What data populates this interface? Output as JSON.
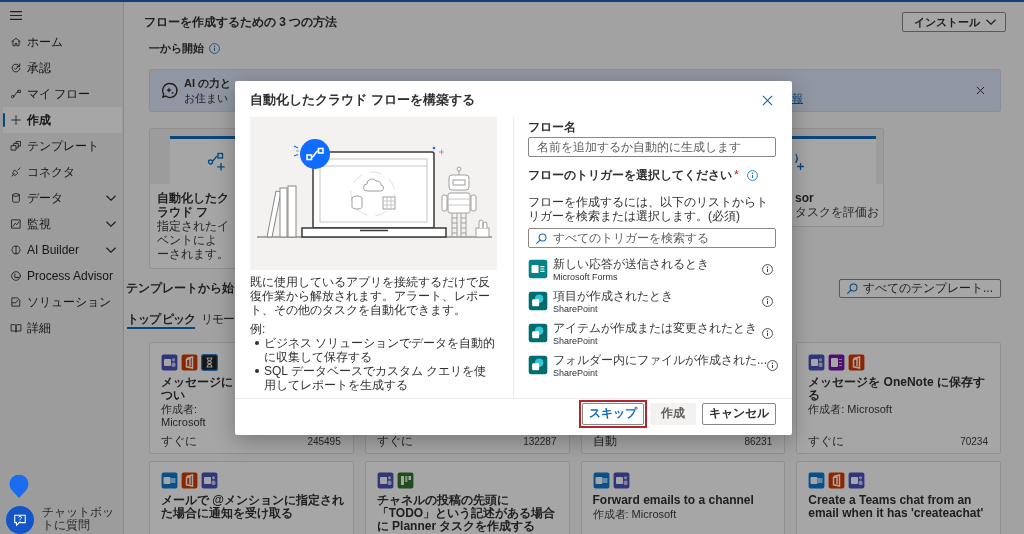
{
  "sidebar": {
    "items": [
      {
        "label": "ホーム",
        "selected": false,
        "expandable": false
      },
      {
        "label": "承認",
        "selected": false,
        "expandable": false
      },
      {
        "label": "マイ フロー",
        "selected": false,
        "expandable": false
      },
      {
        "label": "作成",
        "selected": true,
        "expandable": false
      },
      {
        "label": "テンプレート",
        "selected": false,
        "expandable": false
      },
      {
        "label": "コネクタ",
        "selected": false,
        "expandable": false
      },
      {
        "label": "データ",
        "selected": false,
        "expandable": true
      },
      {
        "label": "監視",
        "selected": false,
        "expandable": true
      },
      {
        "label": "AI Builder",
        "selected": false,
        "expandable": true
      },
      {
        "label": "Process Advisor",
        "selected": false,
        "expandable": false
      },
      {
        "label": "ソリューション",
        "selected": false,
        "expandable": false
      },
      {
        "label": "詳細",
        "selected": false,
        "expandable": false
      }
    ],
    "chatbot_label": "チャットボットに質問"
  },
  "header": {
    "title": "フローを作成するための 3 つの方法",
    "install_button": "インストール"
  },
  "start": {
    "heading": "一から開始",
    "banner": {
      "title": "AI の力と",
      "subtitle": "お住まい",
      "link": "報"
    },
    "cards": [
      {
        "kind": "automated",
        "title": "自動化したクラウド フ",
        "description_lines": [
          "指定されたイベントによ",
          "ーされます。"
        ]
      },
      {
        "kind": "advisor",
        "title": "sor",
        "description_lines": [
          "タスクを評価お"
        ]
      }
    ]
  },
  "templates": {
    "heading": "テンプレートから始",
    "search_button": "すべてのテンプレート...",
    "tabs": [
      {
        "label": "トップ ピック",
        "selected": true
      },
      {
        "label": "リモー",
        "selected": false
      }
    ],
    "rows": [
      {
        "cards": [
          {
            "apps": [
              {
                "kind": "teams"
              },
              {
                "kind": "office"
              },
              {
                "kind": "timer"
              }
            ],
            "title": "メッセージについ",
            "author": "作成者: Microsoft",
            "trigger": "すぐに",
            "count": "245495"
          },
          {
            "trigger": "すぐに",
            "count": "132287"
          },
          {
            "trigger": "自動",
            "count": "86231"
          },
          {
            "apps": [
              {
                "kind": "teams"
              },
              {
                "kind": "onenote"
              },
              {
                "kind": "office"
              }
            ],
            "title": "メッセージを OneNote に保存する",
            "author": "作成者: Microsoft",
            "trigger": "すぐに",
            "count": "70234"
          }
        ]
      },
      {
        "cards": [
          {
            "apps": [
              {
                "kind": "outlook"
              },
              {
                "kind": "office"
              },
              {
                "kind": "teams"
              }
            ],
            "title": "メールで @メンションに指定された場合に通知を受け取る"
          },
          {
            "apps": [
              {
                "kind": "teams"
              },
              {
                "kind": "planner"
              }
            ],
            "title": "チャネルの投稿の先頭に「TODO」という記述がある場合に Planner タスクを作成する"
          },
          {
            "apps": [
              {
                "kind": "outlook"
              },
              {
                "kind": "teams"
              }
            ],
            "title": "Forward emails to a channel",
            "author": "作成者: Microsoft"
          },
          {
            "apps": [
              {
                "kind": "outlook"
              },
              {
                "kind": "office"
              },
              {
                "kind": "teams"
              }
            ],
            "title": "Create a Teams chat from an email when it has 'createachat'"
          }
        ]
      }
    ]
  },
  "dialog": {
    "title": "自動化したクラウド フローを構築する",
    "description": "既に使用しているアプリを接続するだけで反復作業から解放されます。アラート、レポート、その他のタスクを自動化できます。",
    "examples_label": "例:",
    "examples": [
      "ビジネス ソリューションでデータを自動的に収集して保存する",
      "SQL データベースでカスタム クエリを使用してレポートを生成する"
    ],
    "name_field": {
      "label": "フロー名",
      "placeholder": "名前を追加するか自動的に生成します"
    },
    "trigger_field": {
      "label": "フローのトリガーを選択してください",
      "required_mark": "*",
      "help": "フローを作成するには、以下のリストからトリガーを検索または選択します。(必須)",
      "search": {
        "placeholder": "すべてのトリガーを検索する"
      }
    },
    "triggers": [
      {
        "kind": "forms",
        "title": "新しい応答が送信されるとき",
        "connector": "Microsoft Forms"
      },
      {
        "kind": "sharepoint",
        "title": "項目が作成されたとき",
        "connector": "SharePoint"
      },
      {
        "kind": "sharepoint",
        "title": "アイテムが作成または変更されたとき",
        "connector": "SharePoint"
      },
      {
        "kind": "sharepoint",
        "title": "フォルダー内にファイルが作成された...",
        "connector": "SharePoint"
      }
    ],
    "buttons": [
      {
        "label": "スキップ",
        "kind": "accent",
        "disabled": false,
        "highlighted": true
      },
      {
        "label": "作成",
        "kind": "standard",
        "disabled": true,
        "highlighted": false
      },
      {
        "label": "キャンセル",
        "kind": "standard",
        "disabled": false,
        "highlighted": false
      }
    ]
  }
}
